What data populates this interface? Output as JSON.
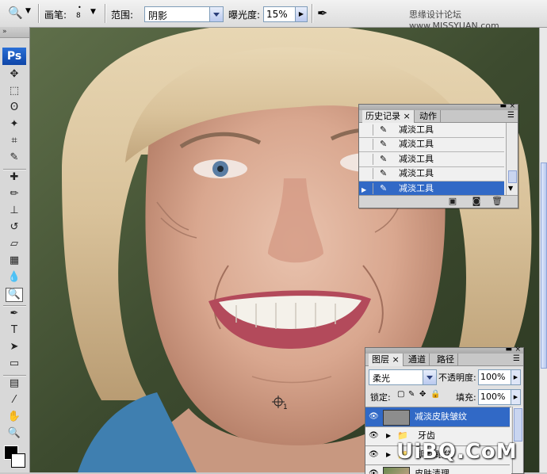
{
  "options_bar": {
    "brush_label": "画笔:",
    "brush_size": "8",
    "range_label": "范围:",
    "range_value": "阴影",
    "exposure_label": "曝光度:",
    "exposure_value": "15%",
    "watermark": "思缘设计论坛 www.MISSYUAN.com"
  },
  "toolbox": {
    "grip": "»",
    "logo": "Ps",
    "tools": [
      {
        "name": "move-tool",
        "glyph": "✥"
      },
      {
        "name": "marquee-tool",
        "glyph": "⬚"
      },
      {
        "name": "lasso-tool",
        "glyph": "ʘ"
      },
      {
        "name": "magic-wand-tool",
        "glyph": "✦"
      },
      {
        "name": "crop-tool",
        "glyph": "⌗"
      },
      {
        "name": "eyedropper-tool",
        "glyph": "✎"
      },
      {
        "name": "healing-brush-tool",
        "glyph": "✚"
      },
      {
        "name": "brush-tool",
        "glyph": "✏"
      },
      {
        "name": "clone-stamp-tool",
        "glyph": "⊥"
      },
      {
        "name": "history-brush-tool",
        "glyph": "↺"
      },
      {
        "name": "eraser-tool",
        "glyph": "▱"
      },
      {
        "name": "gradient-tool",
        "glyph": "▦"
      },
      {
        "name": "blur-tool",
        "glyph": "💧"
      },
      {
        "name": "dodge-tool",
        "glyph": "🔍"
      },
      {
        "name": "pen-tool",
        "glyph": "✒"
      },
      {
        "name": "type-tool",
        "glyph": "T"
      },
      {
        "name": "path-selection-tool",
        "glyph": "➤"
      },
      {
        "name": "shape-tool",
        "glyph": "▭"
      },
      {
        "name": "notes-tool",
        "glyph": "▤"
      },
      {
        "name": "eyedropper2-tool",
        "glyph": "⁄"
      },
      {
        "name": "hand-tool",
        "glyph": "✋"
      },
      {
        "name": "zoom-tool",
        "glyph": "🔍"
      }
    ]
  },
  "history_panel": {
    "tabs": [
      "历史记录",
      "动作"
    ],
    "tab_close": "×",
    "items": [
      "减淡工具",
      "减淡工具",
      "减淡工具",
      "减淡工具",
      "减淡工具"
    ],
    "selected_index": 4
  },
  "layers_panel": {
    "tabs": [
      "图层",
      "通道",
      "路径"
    ],
    "tab_close": "×",
    "blend_mode": "柔光",
    "opacity_label": "不透明度:",
    "opacity_value": "100%",
    "lock_label": "锁定:",
    "fill_label": "填充:",
    "fill_value": "100%",
    "layers": [
      {
        "name": "减淡皮肤皱纹",
        "type": "layer",
        "selected": true
      },
      {
        "name": "牙齿",
        "type": "group",
        "selected": false
      },
      {
        "name": "调整眼袋",
        "type": "group",
        "selected": false
      },
      {
        "name": "皮肤清理",
        "type": "layer",
        "selected": false
      }
    ]
  },
  "overlay_watermark": "UiBQ.CoM",
  "cursor_label": "1",
  "colors": {
    "selection": "#3169c6",
    "panel_bg": "#e1e1e1"
  }
}
